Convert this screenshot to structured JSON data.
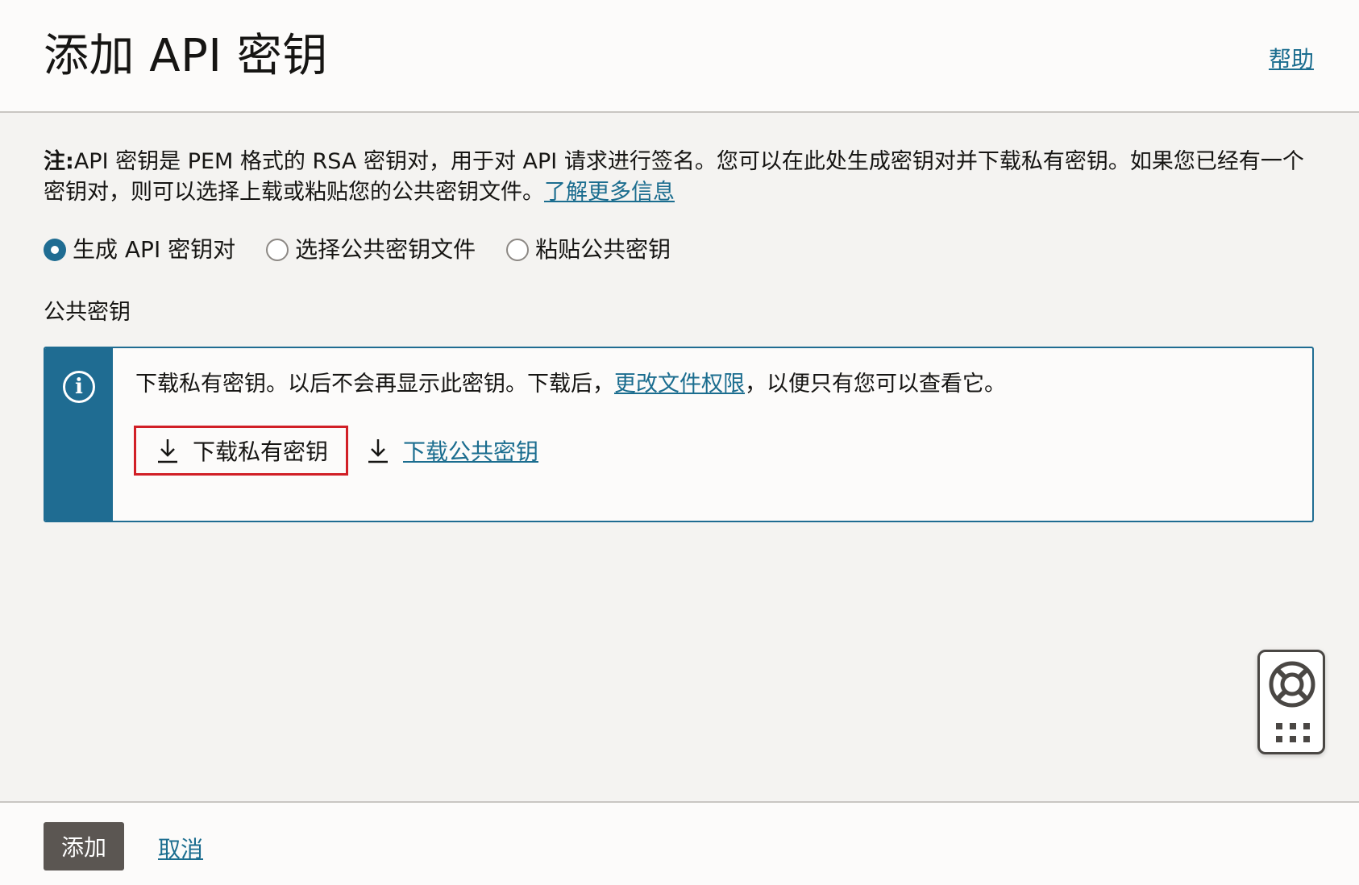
{
  "header": {
    "title": "添加 API 密钥",
    "help_label": "帮助"
  },
  "note": {
    "prefix": "注:",
    "text": "API 密钥是 PEM 格式的 RSA 密钥对，用于对 API 请求进行签名。您可以在此处生成密钥对并下载私有密钥。如果您已经有一个密钥对，则可以选择上载或粘贴您的公共密钥文件。",
    "learn_more": "了解更多信息"
  },
  "radio_options": [
    {
      "label": "生成 API 密钥对",
      "checked": true
    },
    {
      "label": "选择公共密钥文件",
      "checked": false
    },
    {
      "label": "粘贴公共密钥",
      "checked": false
    }
  ],
  "section_label": "公共密钥",
  "info": {
    "icon": "info-circle-icon",
    "text_before": "下载私有密钥。以后不会再显示此密钥。下载后，",
    "link": "更改文件权限",
    "text_after": "，以便只有您可以查看它。",
    "download_private": "下载私有密钥",
    "download_public": "下载公共密钥"
  },
  "footer": {
    "add_label": "添加",
    "cancel_label": "取消"
  },
  "colors": {
    "accent": "#1f6c92",
    "link": "#1b6d8f",
    "highlight": "#d11f26",
    "primary_button": "#5b5652"
  }
}
